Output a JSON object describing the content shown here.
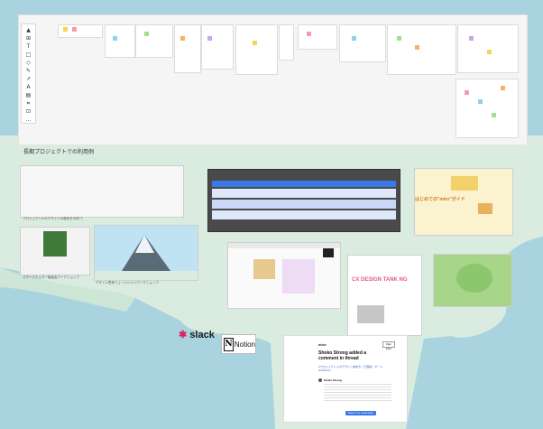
{
  "section_title": "長期プロジェクトでの利用例",
  "toolbar": {
    "tools": [
      {
        "icon": "cursor-icon",
        "glyph": "▲"
      },
      {
        "icon": "frame-icon",
        "glyph": "⊞"
      },
      {
        "icon": "text-icon",
        "glyph": "T"
      },
      {
        "icon": "sticky-note-icon",
        "glyph": "□"
      },
      {
        "icon": "shape-icon",
        "glyph": "◇"
      },
      {
        "icon": "pen-icon",
        "glyph": "✎"
      },
      {
        "icon": "connector-icon",
        "glyph": "↗"
      },
      {
        "icon": "eraser-icon",
        "glyph": "A"
      },
      {
        "icon": "comment-icon",
        "glyph": "▤"
      },
      {
        "icon": "template-icon",
        "glyph": "⌗"
      },
      {
        "icon": "upload-icon",
        "glyph": "⊡"
      },
      {
        "icon": "more-icon",
        "glyph": "…"
      }
    ]
  },
  "thumb_captions": {
    "first": "プロジェクトA のデザインの進め方の例 ①",
    "second": "ステークホルダー勉強会ワークショップ",
    "third": "デザイン思考ミュージシャンワークショップ"
  },
  "guide": {
    "title": "はじめての\"miro\"ガイド"
  },
  "poster": {
    "title": "CX DESIGN TANK NG"
  },
  "logos": {
    "slack": "slack",
    "notion": "Notion"
  },
  "email": {
    "brand": "miro",
    "inbox_label": "Open Inbox",
    "title": "Shoko Strong added a comment in thread",
    "link": "#プロジェクト A のデザイン進め方（工程案）ボードWorkshop",
    "commenter": "Shoko Strong",
    "cta": "Reply in the conversation"
  },
  "colors": {
    "sea": "#a9d3df",
    "island": "#d9ecdf",
    "board_bg": "#f5f5f5",
    "dark_board": "#4a4a4a",
    "accent_blue": "#3a77e8"
  }
}
